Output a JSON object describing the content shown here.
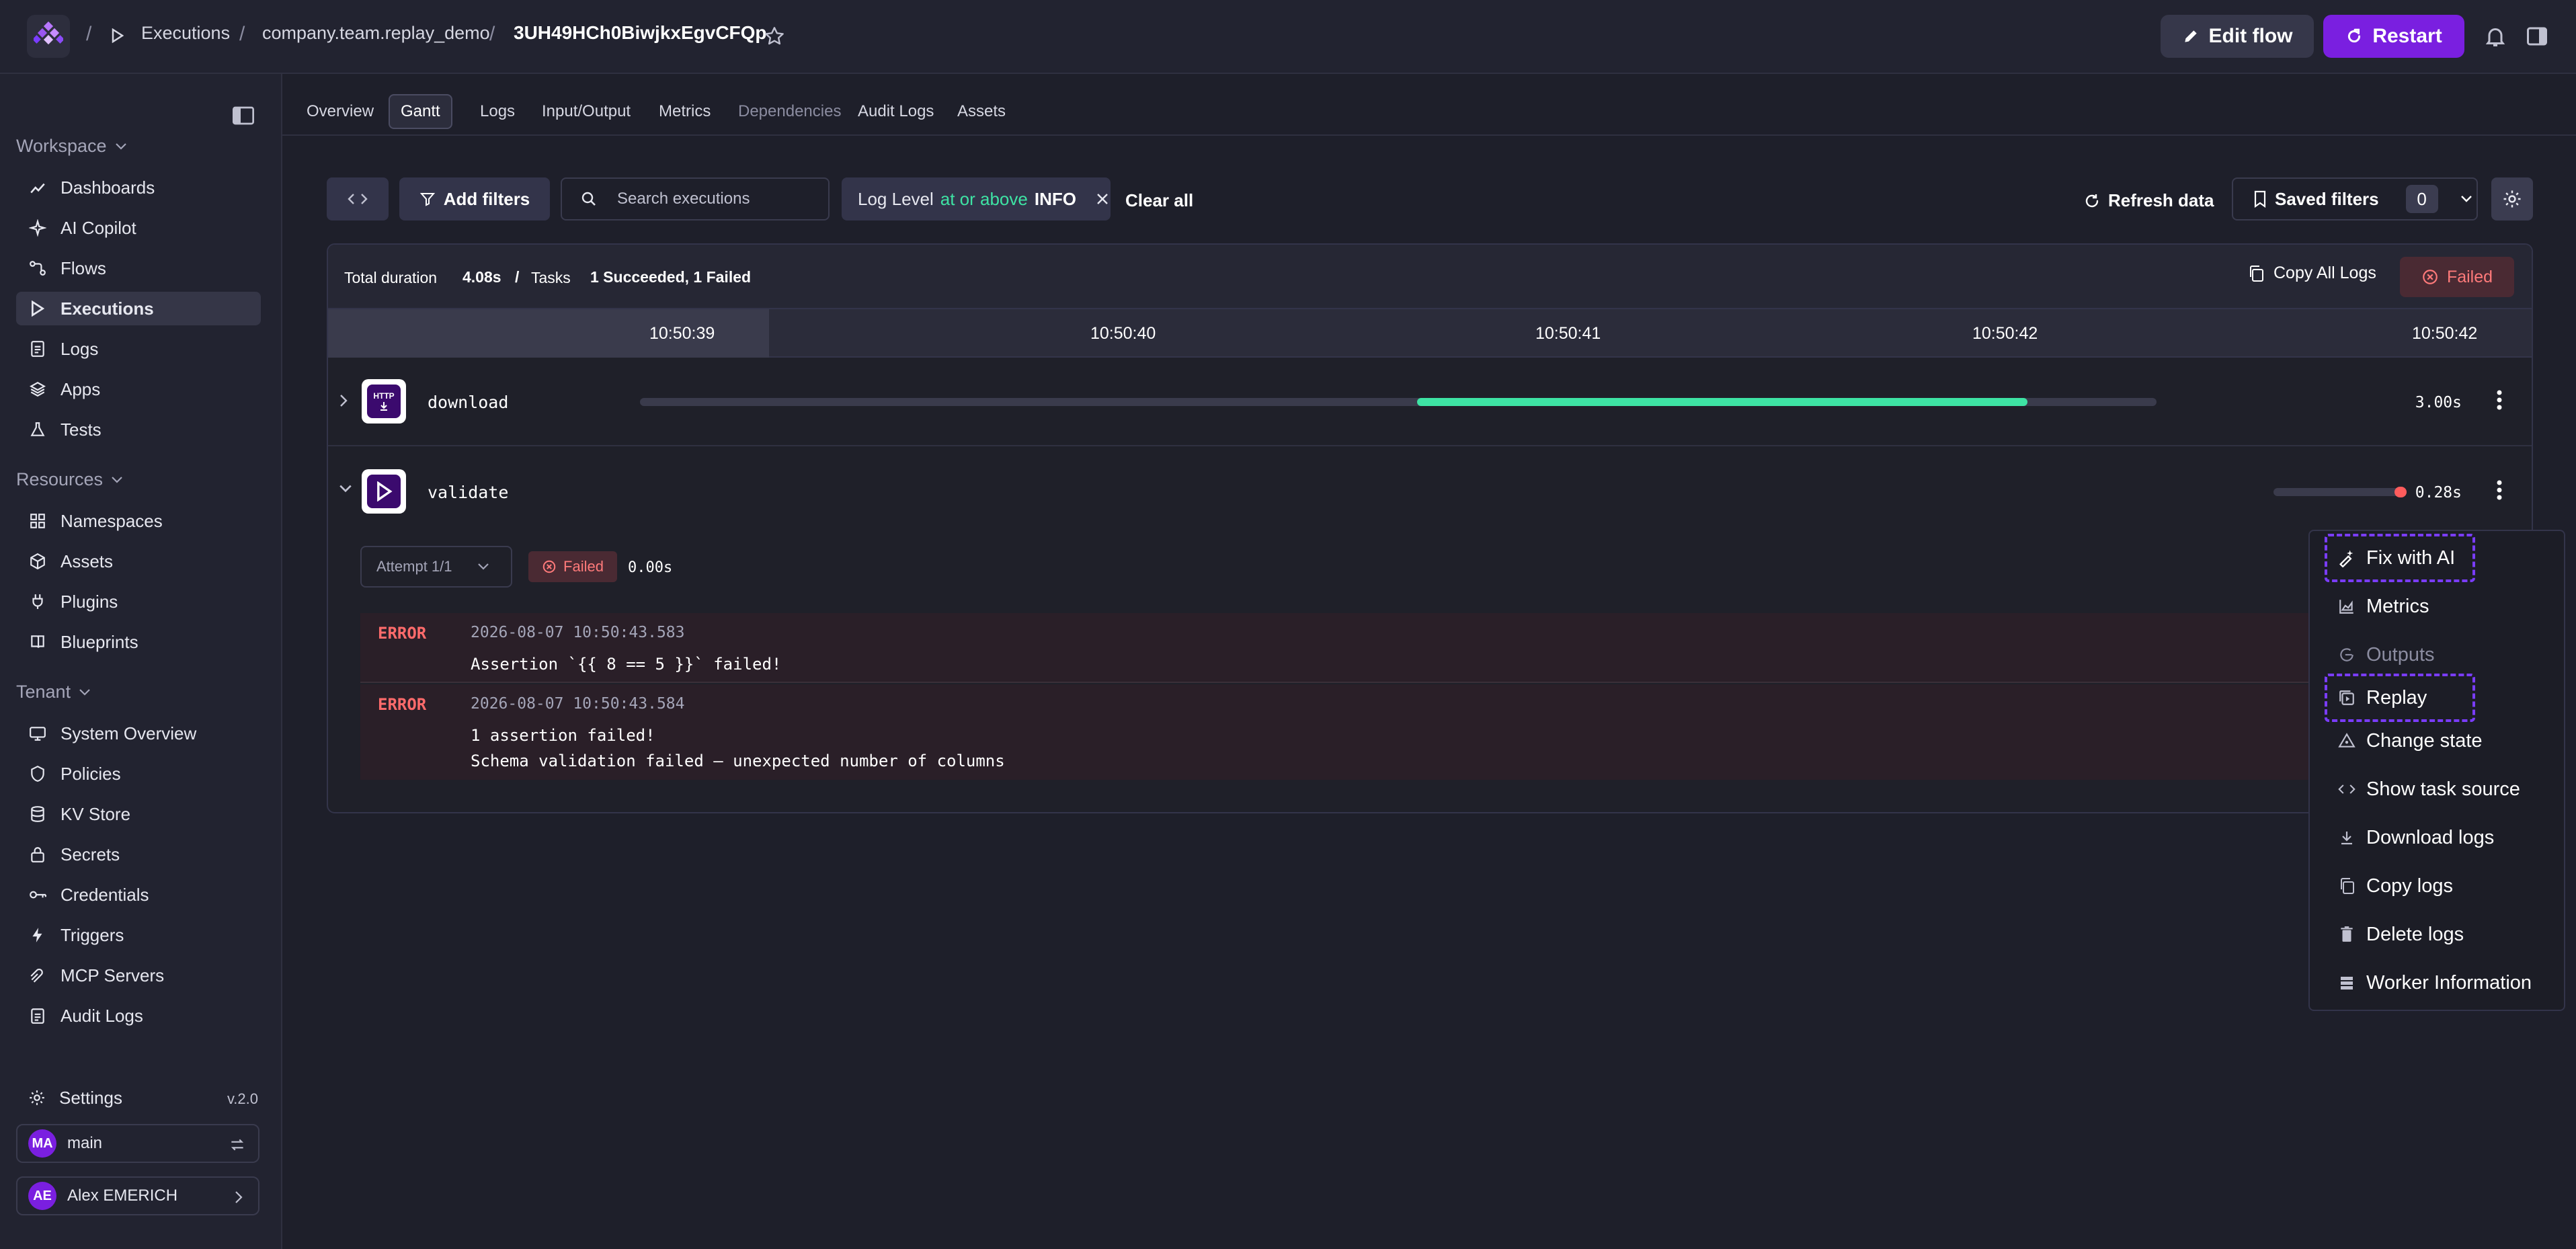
{
  "breadcrumbs": {
    "executions": "Executions",
    "namespace": "company.team.replay_demo",
    "execution_id": "3UH49HCh0BiwjkxEgvCFQp"
  },
  "header": {
    "edit_flow": "Edit flow",
    "restart": "Restart"
  },
  "sidebar": {
    "workspace_label": "Workspace",
    "workspace_items": [
      {
        "label": "Dashboards",
        "icon": "chart-line-icon"
      },
      {
        "label": "AI Copilot",
        "icon": "sparkle-icon"
      },
      {
        "label": "Flows",
        "icon": "flow-icon"
      },
      {
        "label": "Executions",
        "icon": "play-icon",
        "active": true
      },
      {
        "label": "Logs",
        "icon": "file-text-icon"
      },
      {
        "label": "Apps",
        "icon": "layers-icon"
      },
      {
        "label": "Tests",
        "icon": "flask-icon"
      }
    ],
    "resources_label": "Resources",
    "resources_items": [
      {
        "label": "Namespaces",
        "icon": "grid-icon"
      },
      {
        "label": "Assets",
        "icon": "box-icon"
      },
      {
        "label": "Plugins",
        "icon": "plug-icon"
      },
      {
        "label": "Blueprints",
        "icon": "book-icon"
      }
    ],
    "tenant_label": "Tenant",
    "tenant_items": [
      {
        "label": "System Overview",
        "icon": "monitor-icon"
      },
      {
        "label": "Policies",
        "icon": "shield-icon"
      },
      {
        "label": "KV Store",
        "icon": "database-icon"
      },
      {
        "label": "Secrets",
        "icon": "lock-icon"
      },
      {
        "label": "Credentials",
        "icon": "key-icon"
      },
      {
        "label": "Triggers",
        "icon": "bolt-icon"
      },
      {
        "label": "MCP Servers",
        "icon": "server-icon"
      },
      {
        "label": "Audit Logs",
        "icon": "clipboard-icon"
      }
    ],
    "settings": "Settings",
    "version": "v.2.0",
    "namespace_switch": {
      "initials": "MA",
      "label": "main"
    },
    "user": {
      "initials": "AE",
      "label": "Alex EMERICH"
    }
  },
  "tabs": [
    "Overview",
    "Gantt",
    "Logs",
    "Input/Output",
    "Metrics",
    "Dependencies",
    "Audit Logs",
    "Assets"
  ],
  "filters": {
    "add_filters": "Add filters",
    "search_placeholder": "Search executions",
    "chip": {
      "field": "Log Level",
      "operator": "at or above",
      "value": "INFO"
    },
    "clear_all": "Clear all",
    "refresh": "Refresh data",
    "saved_filters": "Saved filters",
    "saved_count": "0"
  },
  "summary": {
    "total_duration_label": "Total duration",
    "total_duration": "4.08s",
    "sep": "/",
    "tasks_label": "Tasks",
    "tasks_value": "1 Succeeded, 1 Failed",
    "copy_all_logs": "Copy All Logs",
    "state": "Failed"
  },
  "timeline_ticks": [
    "10:50:39",
    "10:50:40",
    "10:50:41",
    "10:50:42",
    "10:50:42"
  ],
  "tasks": [
    {
      "name": "download",
      "duration": "3.00s",
      "icon_text": "HTTP",
      "status": "success"
    },
    {
      "name": "validate",
      "duration": "0.28s",
      "status": "failed"
    }
  ],
  "attempt": {
    "label": "Attempt 1/1",
    "state": "Failed",
    "duration": "0.00s"
  },
  "logs": [
    {
      "level": "ERROR",
      "timestamp": "2026-08-07 10:50:43.583",
      "lines": [
        "Assertion `{{ 8 == 5 }}` failed!"
      ]
    },
    {
      "level": "ERROR",
      "timestamp": "2026-08-07 10:50:43.584",
      "lines": [
        "1 assertion failed!",
        "Schema validation failed — unexpected number of columns"
      ]
    }
  ],
  "context_menu": [
    {
      "label": "Fix with AI",
      "icon": "sparkle-pen-icon",
      "highlighted": true
    },
    {
      "label": "Metrics",
      "icon": "area-chart-icon"
    },
    {
      "label": "Outputs",
      "icon": "circle-arrow-icon",
      "disabled": true
    },
    {
      "label": "Replay",
      "icon": "replay-icon",
      "highlighted": true
    },
    {
      "label": "Change state",
      "icon": "state-icon"
    },
    {
      "label": "Show task source",
      "icon": "code-icon"
    },
    {
      "label": "Download logs",
      "icon": "download-icon"
    },
    {
      "label": "Copy logs",
      "icon": "copy-icon"
    },
    {
      "label": "Delete logs",
      "icon": "trash-icon"
    },
    {
      "label": "Worker Information",
      "icon": "server-stack-icon"
    }
  ],
  "colors": {
    "accent": "#7a1fe0",
    "success": "#3ee3a4",
    "error": "#ff6b6b",
    "highlight": "#7a3cff"
  }
}
